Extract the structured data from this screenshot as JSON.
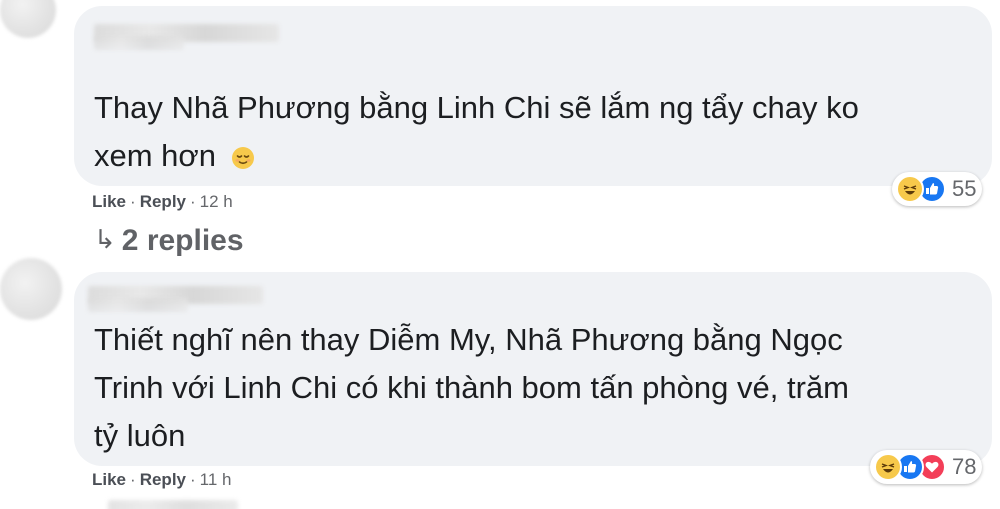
{
  "comments": [
    {
      "text_lines": [
        "Thay Nhã Phương bằng Linh Chi sẽ lắm ng tẩy chay ko",
        "xem hơn"
      ],
      "emoji": "relieved-face",
      "actions": {
        "like": "Like",
        "reply": "Reply",
        "time": "12 h"
      },
      "reactions": {
        "icons": [
          "haha",
          "like"
        ],
        "count": "55"
      },
      "replies_label": "2 replies"
    },
    {
      "text_lines": [
        "Thiết nghĩ nên thay Diễm My, Nhã Phương bằng Ngọc",
        "Trinh với Linh Chi có khi thành bom tấn phòng vé, trăm",
        "tỷ luôn"
      ],
      "actions": {
        "like": "Like",
        "reply": "Reply",
        "time": "11 h"
      },
      "reactions": {
        "icons": [
          "haha",
          "like",
          "love"
        ],
        "count": "78"
      }
    }
  ],
  "colors": {
    "bubble": "#f0f2f5",
    "text": "#1c1e21",
    "meta": "#65676b",
    "like_blue": "#1877f2",
    "haha_yellow": "#f7c94b",
    "love_red": "#f33e58"
  }
}
